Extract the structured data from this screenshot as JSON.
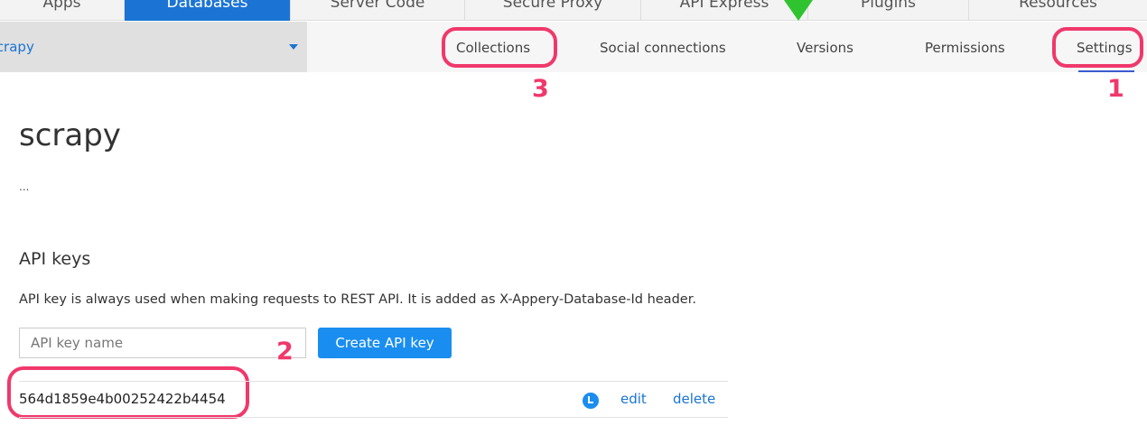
{
  "top_nav": {
    "tabs": [
      {
        "label": "Apps",
        "active": false
      },
      {
        "label": "Databases",
        "active": true
      },
      {
        "label": "Server Code",
        "active": false
      },
      {
        "label": "Secure Proxy",
        "active": false
      },
      {
        "label": "API Express",
        "active": false
      },
      {
        "label": "Plugins",
        "active": false
      },
      {
        "label": "Resources",
        "active": false
      }
    ]
  },
  "sub_nav": {
    "database_selector": "scrapy",
    "items": [
      "Collections",
      "Social connections",
      "Versions",
      "Permissions",
      "Settings"
    ],
    "active": "Settings"
  },
  "annotations": {
    "one": "1",
    "two": "2",
    "three": "3",
    "color": "#f0386b"
  },
  "main": {
    "title": "scrapy",
    "description": "...",
    "api_keys": {
      "heading": "API keys",
      "info": "API key is always used when making requests to REST API. It is added as X-Appery-Database-Id header.",
      "input_placeholder": "API key name",
      "create_label": "Create API key",
      "keys": [
        {
          "value": "564d1859e4b00252422b4454",
          "edit": "edit",
          "delete": "delete"
        }
      ]
    }
  },
  "colors": {
    "accent": "#1b74d4",
    "button": "#1a8ef0"
  }
}
